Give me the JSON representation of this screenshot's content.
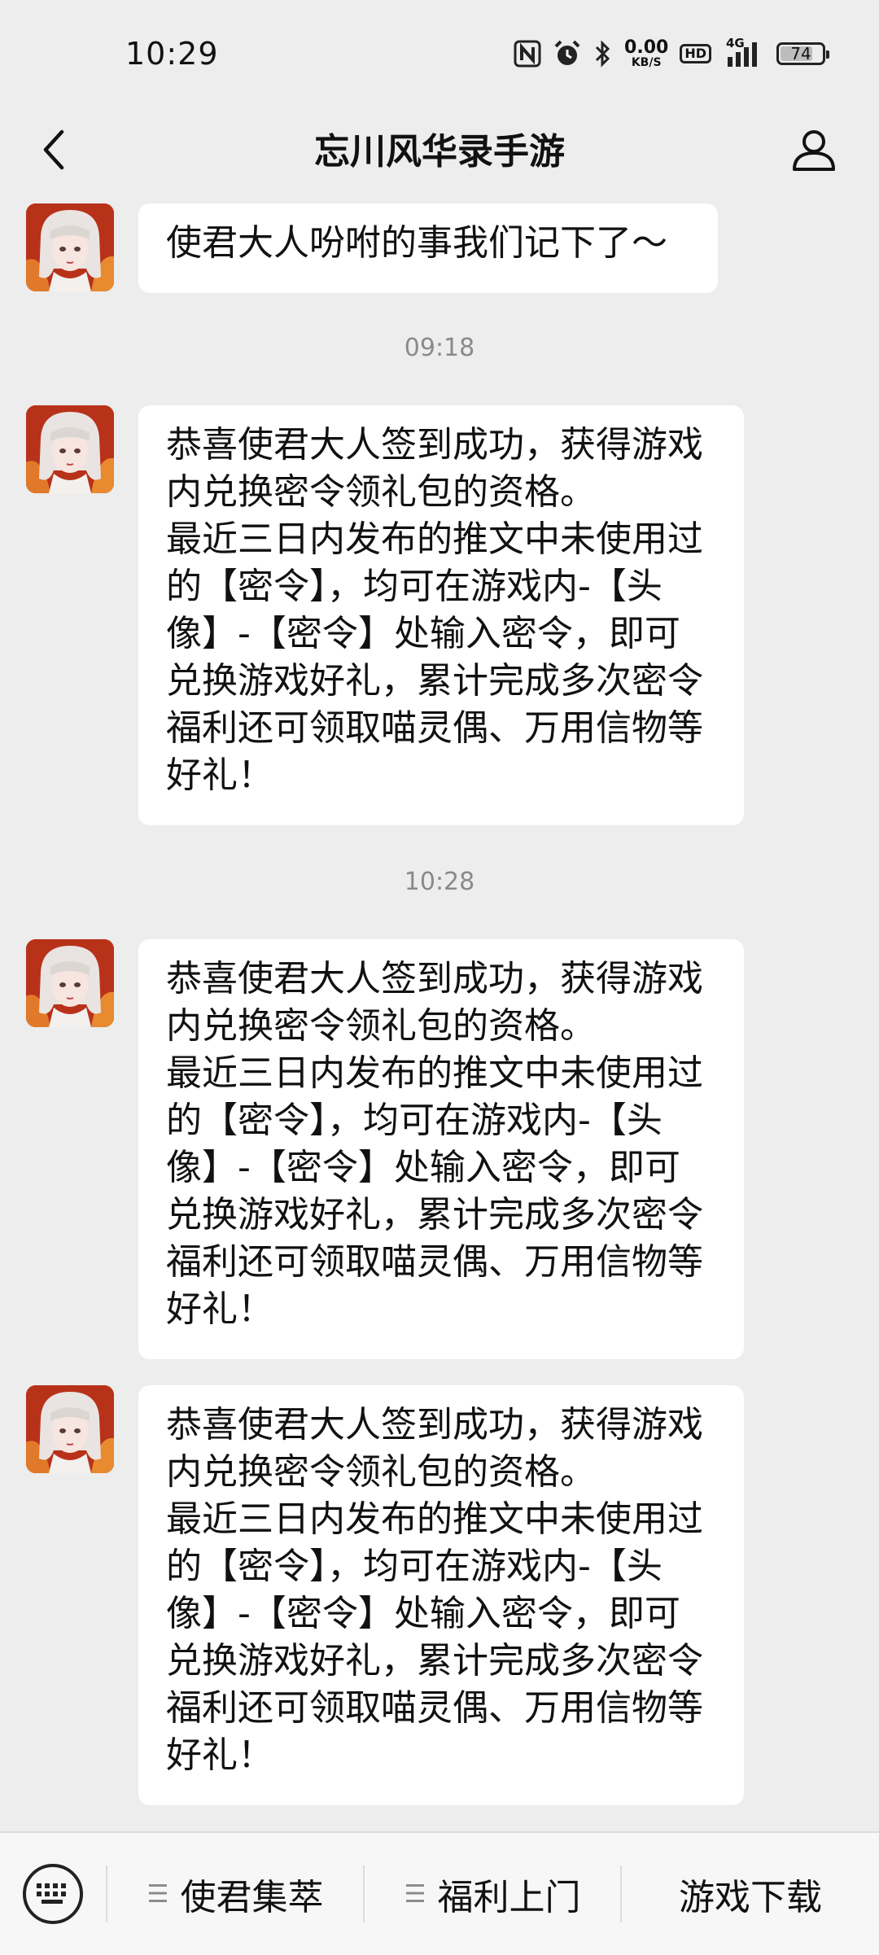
{
  "status_bar": {
    "time": "10:29",
    "net_speed_value": "0.00",
    "net_speed_unit": "KB/S",
    "hd_label": "HD",
    "network_label": "4G",
    "battery": "74"
  },
  "header": {
    "title": "忘川风华录手游"
  },
  "chat": {
    "messages": [
      {
        "text": "使君大人吩咐的事我们记下了～"
      },
      {
        "text": "恭喜使君大人签到成功，获得游戏\n内兑换密令领礼包的资格。\n最近三日内发布的推文中未使用过\n的【密令】，均可在游戏内-【头\n像】-【密令】处输入密令，即可\n兑换游戏好礼，累计完成多次密令\n福利还可领取喵灵偶、万用信物等\n好礼！"
      },
      {
        "text": "恭喜使君大人签到成功，获得游戏\n内兑换密令领礼包的资格。\n最近三日内发布的推文中未使用过\n的【密令】，均可在游戏内-【头\n像】-【密令】处输入密令，即可\n兑换游戏好礼，累计完成多次密令\n福利还可领取喵灵偶、万用信物等\n好礼！"
      },
      {
        "text": "恭喜使君大人签到成功，获得游戏\n内兑换密令领礼包的资格。\n最近三日内发布的推文中未使用过\n的【密令】，均可在游戏内-【头\n像】-【密令】处输入密令，即可\n兑换游戏好礼，累计完成多次密令\n福利还可领取喵灵偶、万用信物等\n好礼！"
      }
    ],
    "timestamps": [
      "09:18",
      "10:28"
    ]
  },
  "bottom_menu": {
    "items": [
      {
        "label": "使君集萃"
      },
      {
        "label": "福利上门"
      },
      {
        "label": "游戏下载"
      }
    ]
  }
}
